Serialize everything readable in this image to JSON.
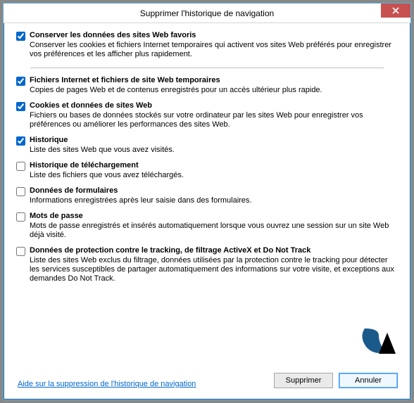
{
  "window": {
    "title": "Supprimer l'historique de navigation"
  },
  "options": [
    {
      "checked": true,
      "label": "Conserver les données des sites Web favoris",
      "desc": "Conserver les cookies et fichiers Internet temporaires qui activent vos sites Web préférés pour enregistrer vos préférences et les afficher plus rapidement."
    },
    {
      "checked": true,
      "label": "Fichiers Internet et fichiers de site Web temporaires",
      "desc": "Copies de pages Web et de contenus enregistrés pour un accès ultérieur plus rapide."
    },
    {
      "checked": true,
      "label": "Cookies et données de sites Web",
      "desc": "Fichiers ou bases de données stockés sur votre ordinateur par les sites Web pour enregistrer vos préférences ou améliorer les performances des sites Web."
    },
    {
      "checked": true,
      "label": "Historique",
      "desc": "Liste des sites Web que vous avez visités."
    },
    {
      "checked": false,
      "label": "Historique de téléchargement",
      "desc": "Liste des fichiers que vous avez téléchargés."
    },
    {
      "checked": false,
      "label": "Données de formulaires",
      "desc": "Informations enregistrées après leur saisie dans des formulaires."
    },
    {
      "checked": false,
      "label": "Mots de passe",
      "desc": "Mots de passe enregistrés et insérés automatiquement lorsque vous ouvrez une session sur un site Web déjà visité."
    },
    {
      "checked": false,
      "label": "Données de protection contre le tracking, de filtrage ActiveX et Do Not Track",
      "desc": "Liste des sites Web exclus du filtrage, données utilisées par la protection contre le tracking pour détecter les services susceptibles de partager automatiquement des informations sur votre visite, et exceptions aux demandes Do Not Track."
    }
  ],
  "help_link": "Aide sur la suppression de l'historique de navigation",
  "buttons": {
    "delete": "Supprimer",
    "cancel": "Annuler"
  }
}
